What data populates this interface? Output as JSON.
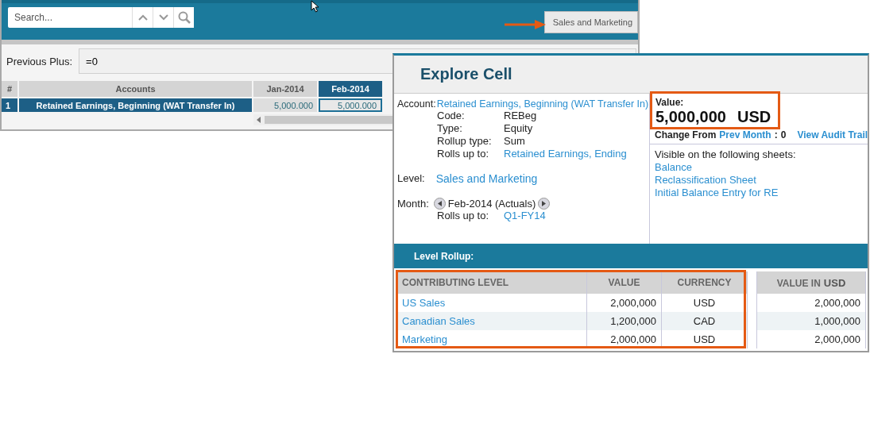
{
  "toolbar": {
    "search": {
      "placeholder": "Search..."
    },
    "level_button": "Sales and Marketing"
  },
  "formula_bar": {
    "label": "Previous Plus:",
    "value": "=0"
  },
  "grid": {
    "number_header": "#",
    "account_header": "Accounts",
    "month_columns": [
      {
        "label": "Jan-2014",
        "selected": false
      },
      {
        "label": "Feb-2014",
        "selected": true
      }
    ],
    "rows": [
      {
        "number": "1",
        "account": "Retained Earnings, Beginning (WAT Transfer In)",
        "selected": true,
        "cells": [
          {
            "value": "5,000.000",
            "selected": false
          },
          {
            "value": "5,000.000",
            "selected": true
          }
        ]
      }
    ]
  },
  "explore_cell": {
    "title": "Explore Cell",
    "account": {
      "label": "Account:",
      "value": "Retained Earnings, Beginning (WAT Transfer In)"
    },
    "details": [
      {
        "label": "Code:",
        "value": "REBeg",
        "kind": "text"
      },
      {
        "label": "Type:",
        "value": "Equity",
        "kind": "text"
      },
      {
        "label": "Rollup type:",
        "value": "Sum",
        "kind": "text"
      },
      {
        "label": "Rolls up to:",
        "value": "Retained Earnings, Ending",
        "kind": "link"
      }
    ],
    "level": {
      "label": "Level:",
      "value": "Sales and Marketing"
    },
    "month": {
      "label": "Month:",
      "value": "Feb-2014 (Actuals)",
      "rolls_label": "Rolls up to:",
      "rolls_value": "Q1-FY14"
    },
    "value": {
      "label": "Value:",
      "amount": "5,000,000",
      "currency": "USD"
    },
    "change": {
      "label": "Change From",
      "link": "Prev Month",
      "colon": ":",
      "amount": "0",
      "audit_link": "View Audit Trail"
    },
    "sheets": {
      "heading": "Visible on the following sheets:",
      "links": [
        "Balance",
        "Reclassification Sheet",
        "Initial Balance Entry for RE"
      ]
    },
    "rollup": {
      "title": "Level Rollup:",
      "columns": [
        "CONTRIBUTING LEVEL",
        "VALUE",
        "CURRENCY"
      ],
      "converted_label": "VALUE IN",
      "converted_currency": "USD",
      "rows": [
        {
          "level": "US Sales",
          "value": "2,000,000",
          "currency": "USD",
          "converted": "2,000,000"
        },
        {
          "level": "Canadian Sales",
          "value": "1,200,000",
          "currency": "CAD",
          "converted": "1,000,000"
        },
        {
          "level": "Marketing",
          "value": "2,000,000",
          "currency": "USD",
          "converted": "2,000,000"
        }
      ]
    }
  }
}
